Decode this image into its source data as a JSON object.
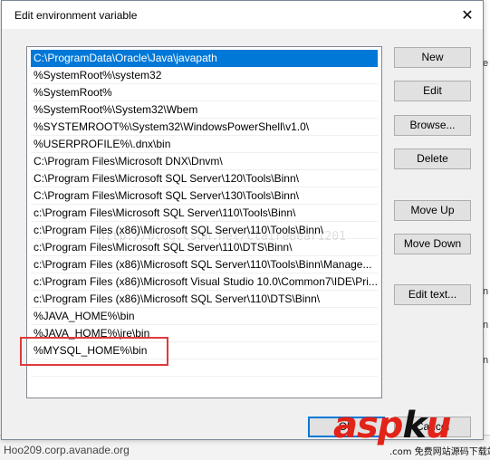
{
  "window": {
    "title": "Edit environment variable",
    "close_glyph": "✕"
  },
  "path_entries": [
    {
      "text": "C:\\ProgramData\\Oracle\\Java\\javapath",
      "selected": true
    },
    {
      "text": "%SystemRoot%\\system32",
      "selected": false
    },
    {
      "text": "%SystemRoot%",
      "selected": false
    },
    {
      "text": "%SystemRoot%\\System32\\Wbem",
      "selected": false
    },
    {
      "text": "%SYSTEMROOT%\\System32\\WindowsPowerShell\\v1.0\\",
      "selected": false
    },
    {
      "text": "%USERPROFILE%\\.dnx\\bin",
      "selected": false
    },
    {
      "text": "C:\\Program Files\\Microsoft DNX\\Dnvm\\",
      "selected": false
    },
    {
      "text": "C:\\Program Files\\Microsoft SQL Server\\120\\Tools\\Binn\\",
      "selected": false
    },
    {
      "text": "C:\\Program Files\\Microsoft SQL Server\\130\\Tools\\Binn\\",
      "selected": false
    },
    {
      "text": "c:\\Program Files\\Microsoft SQL Server\\110\\Tools\\Binn\\",
      "selected": false
    },
    {
      "text": "c:\\Program Files (x86)\\Microsoft SQL Server\\110\\Tools\\Binn\\",
      "selected": false
    },
    {
      "text": "c:\\Program Files\\Microsoft SQL Server\\110\\DTS\\Binn\\",
      "selected": false
    },
    {
      "text": "c:\\Program Files (x86)\\Microsoft SQL Server\\110\\Tools\\Binn\\Manage...",
      "selected": false
    },
    {
      "text": "c:\\Program Files (x86)\\Microsoft Visual Studio 10.0\\Common7\\IDE\\Pri...",
      "selected": false
    },
    {
      "text": "c:\\Program Files (x86)\\Microsoft SQL Server\\110\\DTS\\Binn\\",
      "selected": false
    },
    {
      "text": "%JAVA_HOME%\\bin",
      "selected": false
    },
    {
      "text": "%JAVA_HOME%\\jre\\bin",
      "selected": false
    },
    {
      "text": "%MYSQL_HOME%\\bin",
      "selected": false
    },
    {
      "text": "",
      "selected": false
    }
  ],
  "buttons": {
    "new": "New",
    "edit": "Edit",
    "browse": "Browse...",
    "delete": "Delete",
    "move_up": "Move Up",
    "move_down": "Move Down",
    "edit_text": "Edit text...",
    "ok": "OK",
    "cancel": "Cancel"
  },
  "watermark": "http://blog.csdn.net/ClaireBear1201",
  "logo": {
    "word_red_1": "asp",
    "word_dark": "k",
    "word_red_2": "u",
    "word_dark_2": ".com",
    "sub": "免费网站源码下载站"
  },
  "background": {
    "bottom_text": "Hoo209.corp.avanade.org",
    "left_fragments": [
      "g",
      "d",
      "e"
    ],
    "right_fragments": [
      "e",
      "n",
      "n",
      "n"
    ]
  },
  "colors": {
    "selection": "#0078d7",
    "highlight_border": "#e03a3a",
    "logo_red": "#e2231a"
  }
}
